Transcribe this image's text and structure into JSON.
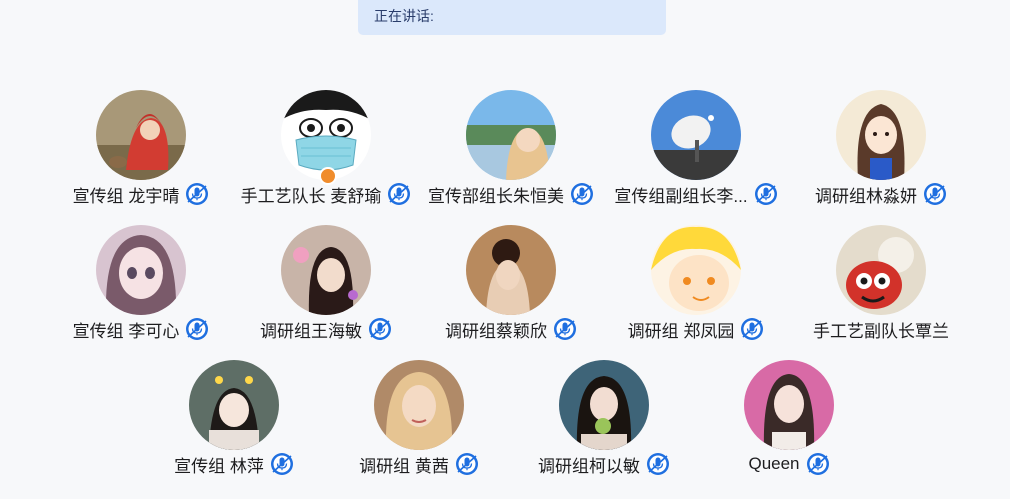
{
  "banner": {
    "label": "正在讲话:"
  },
  "participants": [
    {
      "name": "宣传组 龙宇晴",
      "avatar": "girl-red-hood-avatar",
      "bg": [
        "#8b7b5e",
        "#c84a3a"
      ],
      "mic": "mic-icon"
    },
    {
      "name": "手工艺队长 麦舒瑜",
      "avatar": "cartoon-mask-avatar",
      "bg": [
        "#ffffff",
        "#7fd0e0"
      ],
      "mic": "mic-icon",
      "host": true
    },
    {
      "name": "宣传部组长朱恒美",
      "avatar": "lake-blonde-avatar",
      "bg": [
        "#6ab0e8",
        "#e8c9a6"
      ],
      "mic": "mic-icon"
    },
    {
      "name": "宣传组副组长李...",
      "avatar": "satellite-dish-avatar",
      "bg": [
        "#4a86d8",
        "#f0f0f0"
      ],
      "mic": "mic-icon"
    },
    {
      "name": "调研组林淼妍",
      "avatar": "cartoon-girl-avatar",
      "bg": [
        "#f4e8d0",
        "#5a3a2a"
      ],
      "mic": "mic-icon"
    },
    {
      "name": "宣传组 李可心",
      "avatar": "anime-girl-avatar",
      "bg": [
        "#cfb8c8",
        "#6a5060"
      ],
      "mic": "mic-icon"
    },
    {
      "name": "调研组王海敏",
      "avatar": "girl-selfie-avatar",
      "bg": [
        "#d0b8a8",
        "#2a1a18"
      ],
      "mic": "mic-icon"
    },
    {
      "name": "调研组蔡颖欣",
      "avatar": "girl-updo-avatar",
      "bg": [
        "#b8845a",
        "#3a2218"
      ],
      "mic": "mic-icon"
    },
    {
      "name": "调研组 郑凤园",
      "avatar": "cartoon-boy-avatar",
      "bg": [
        "#ffe070",
        "#fbe3c8"
      ],
      "mic": "mic-icon"
    },
    {
      "name": "手工艺副队长覃兰",
      "avatar": "cat-doll-avatar",
      "bg": [
        "#e8e0d0",
        "#c83a2a"
      ],
      "mic": "mic-icon"
    },
    {
      "name": "宣传组 林萍",
      "avatar": "child-photo-avatar",
      "bg": [
        "#6a7a70",
        "#f0e8e0"
      ],
      "mic": "mic-icon"
    },
    {
      "name": "调研组 黄茜",
      "avatar": "blonde-woman-avatar",
      "bg": [
        "#c89a70",
        "#e8c8a0"
      ],
      "mic": "mic-icon"
    },
    {
      "name": "调研组柯以敏",
      "avatar": "girl-apple-avatar",
      "bg": [
        "#3a5a70",
        "#e0d0c8"
      ],
      "mic": "mic-icon"
    },
    {
      "name": "Queen",
      "avatar": "woman-portrait-avatar",
      "bg": [
        "#d86aa0",
        "#f0d8d0"
      ],
      "mic": "mic-icon"
    }
  ]
}
